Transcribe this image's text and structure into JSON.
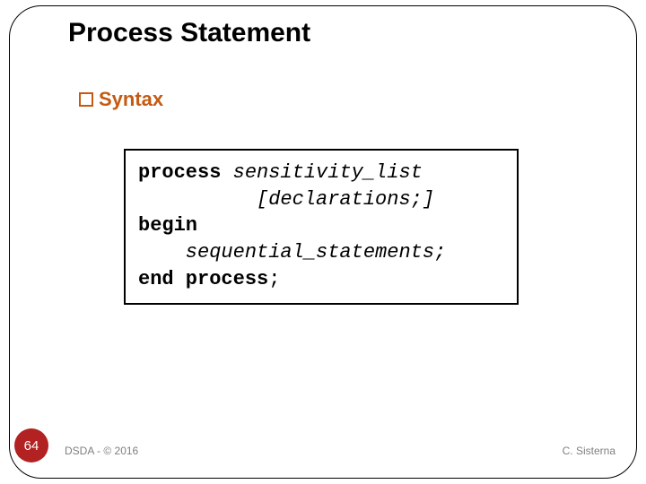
{
  "title": "Process Statement",
  "bullet": {
    "label": "Syntax"
  },
  "code": {
    "l1a": "process ",
    "l1b": "sensitivity_list",
    "l2": "          [declarations;]",
    "l3": "begin",
    "l4": "    sequential_statements;",
    "l5a": "end process",
    "l5b": ";"
  },
  "page_number": "64",
  "footer_left": "DSDA - © 2016",
  "footer_right": "C. Sisterna"
}
